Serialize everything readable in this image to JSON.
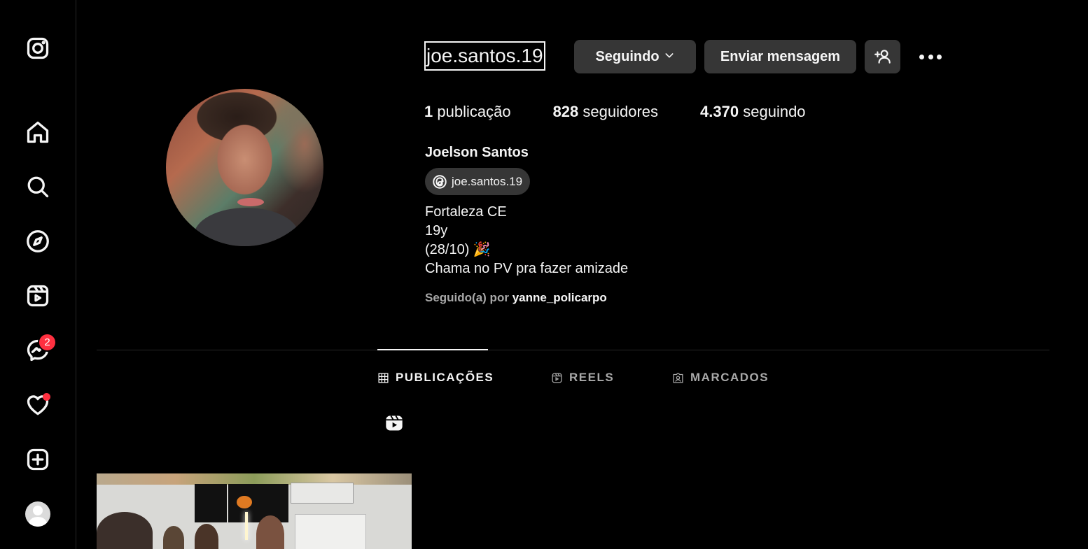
{
  "sidebar": {
    "items": [
      {
        "name": "instagram-logo",
        "icon": "instagram-icon"
      },
      {
        "name": "home",
        "icon": "home-icon"
      },
      {
        "name": "search",
        "icon": "search-icon"
      },
      {
        "name": "explore",
        "icon": "compass-icon"
      },
      {
        "name": "reels",
        "icon": "reels-icon"
      },
      {
        "name": "messages",
        "icon": "messenger-icon"
      },
      {
        "name": "notifications",
        "icon": "heart-icon"
      },
      {
        "name": "create",
        "icon": "plus-square-icon"
      },
      {
        "name": "profile",
        "icon": "avatar"
      }
    ],
    "messages_badge": "2"
  },
  "profile": {
    "username": "joe.santos.19",
    "follow_button": "Seguindo",
    "message_button": "Enviar mensagem",
    "stats": {
      "posts_count": "1",
      "posts_label": "publicação",
      "followers_count": "828",
      "followers_label": "seguidores",
      "following_count": "4.370",
      "following_label": "seguindo"
    },
    "full_name": "Joelson Santos",
    "threads_handle": "joe.santos.19",
    "bio": [
      "Fortaleza CE",
      "19y",
      "(28/10) 🎉",
      "Chama no PV pra fazer amizade"
    ],
    "followed_by_prefix": "Seguido(a) por",
    "followed_by_user": "yanne_policarpo"
  },
  "tabs": [
    {
      "label": "PUBLICAÇÕES",
      "icon": "grid-icon",
      "active": true
    },
    {
      "label": "REELS",
      "icon": "reels-icon",
      "active": false
    },
    {
      "label": "MARCADOS",
      "icon": "tagged-icon",
      "active": false
    }
  ],
  "colors": {
    "background": "#000000",
    "button": "#363636",
    "badge": "#ff3040",
    "muted_text": "#a8a8a8"
  }
}
